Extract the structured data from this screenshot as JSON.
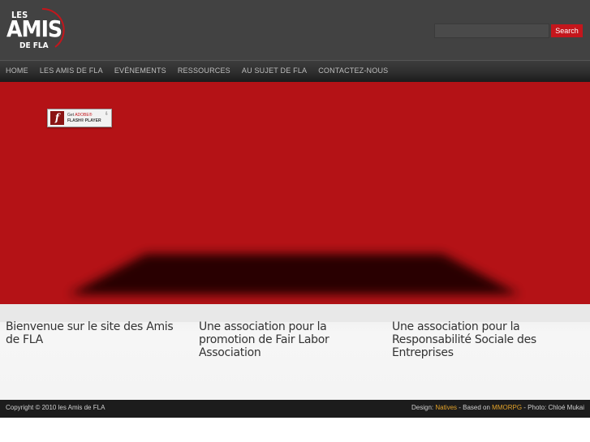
{
  "logo": {
    "line1": "LES",
    "line2": "AMIS",
    "line3": "DE FLA"
  },
  "search": {
    "placeholder": "",
    "value": "",
    "button_label": "Search"
  },
  "nav": {
    "items": [
      {
        "label": "HOME"
      },
      {
        "label": "LES AMIS DE FLA"
      },
      {
        "label": "EVÉNEMENTS"
      },
      {
        "label": "RESSOURCES"
      },
      {
        "label": "AU SUJET DE FLA"
      },
      {
        "label": "CONTACTEZ-NOUS"
      }
    ]
  },
  "flash_badge": {
    "get": "Get",
    "adobe": "ADOBE®",
    "player": "FLASH® PLAYER"
  },
  "columns": [
    {
      "text": "Bienvenue sur le site des Amis de FLA"
    },
    {
      "text": "Une association pour la promotion de Fair Labor Association"
    },
    {
      "text": "Une association pour la Responsabilité Sociale des Entreprises"
    }
  ],
  "footer": {
    "copyright": "Copyright © 2010 les Amis de FLA",
    "design_label": "Design: ",
    "design_link": "Natives",
    "based_label": " - Based on ",
    "based_link": "MMORPG",
    "photo": " - Photo: Chloé Mukai"
  },
  "colors": {
    "accent": "#c4161c",
    "banner": "#b41216",
    "footer_link": "#e2a22a"
  }
}
